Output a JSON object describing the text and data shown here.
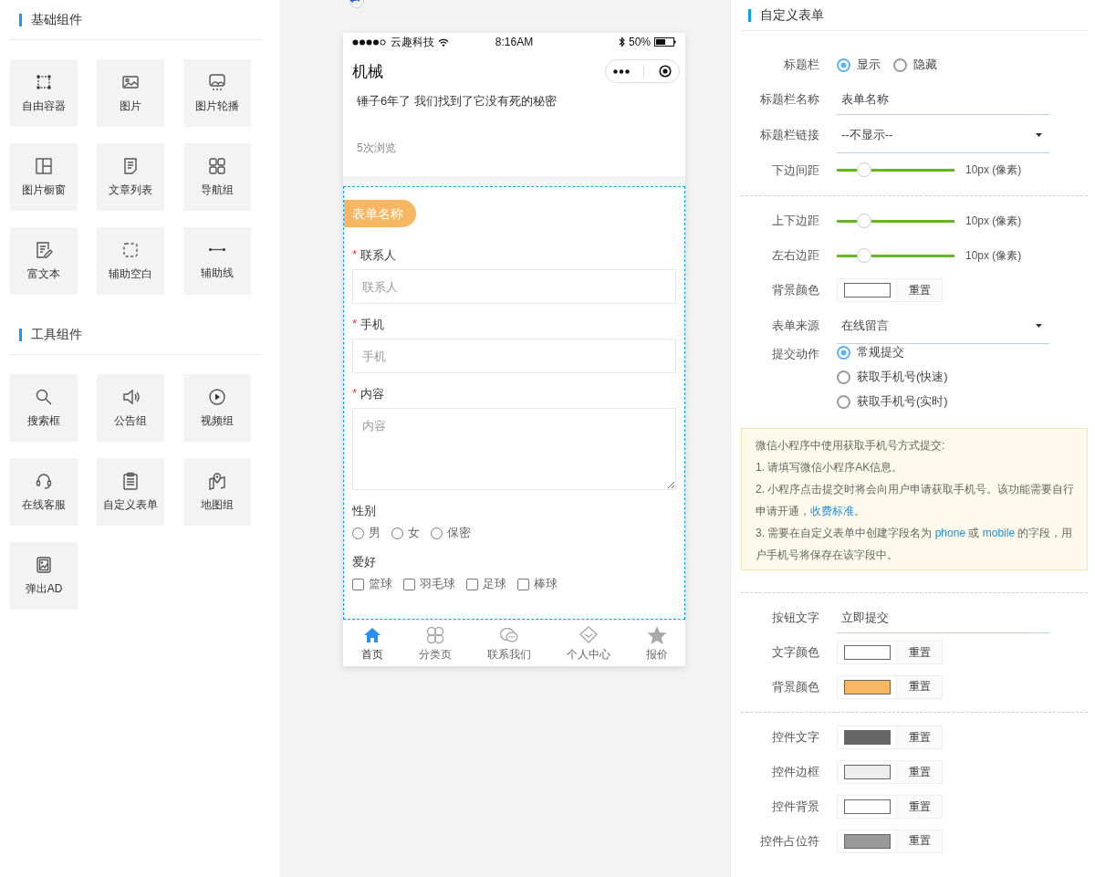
{
  "components": {
    "sections": [
      {
        "title": "基础组件",
        "items": [
          {
            "label": "自由容器"
          },
          {
            "label": "图片"
          },
          {
            "label": "图片轮播"
          },
          {
            "label": "图片橱窗"
          },
          {
            "label": "文章列表"
          },
          {
            "label": "导航组"
          },
          {
            "label": "富文本"
          },
          {
            "label": "辅助空白"
          },
          {
            "label": "辅助线"
          }
        ]
      },
      {
        "title": "工具组件",
        "items": [
          {
            "label": "搜索框"
          },
          {
            "label": "公告组"
          },
          {
            "label": "视频组"
          },
          {
            "label": "在线客服"
          },
          {
            "label": "自定义表单"
          },
          {
            "label": "地图组"
          },
          {
            "label": "弹出AD"
          }
        ]
      }
    ]
  },
  "phone": {
    "status_bar": {
      "carrier": "云趣科技",
      "time": "8:16AM",
      "battery": "50%"
    },
    "nav": {
      "title": "机械"
    },
    "article": {
      "title": "锤子6年了 我们找到了它没有死的秘密",
      "views": "5次浏览"
    },
    "form": {
      "title": "表单名称",
      "fields": [
        {
          "kind": "text",
          "label": "联系人",
          "required_mark": "*",
          "placeholder": "联系人"
        },
        {
          "kind": "text",
          "label": "手机",
          "required_mark": "*",
          "placeholder": "手机"
        },
        {
          "kind": "textarea",
          "label": "内容",
          "required_mark": "*",
          "placeholder": "内容"
        },
        {
          "kind": "radio",
          "label": "性别",
          "options": [
            {
              "label": "男",
              "selected": false
            },
            {
              "label": "女",
              "selected": false
            },
            {
              "label": "保密",
              "selected": false
            }
          ]
        },
        {
          "kind": "checkbox",
          "label": "爱好",
          "options": [
            {
              "label": "篮球",
              "checked": false
            },
            {
              "label": "羽毛球",
              "checked": false
            },
            {
              "label": "足球",
              "checked": false
            },
            {
              "label": "棒球",
              "checked": false
            }
          ]
        }
      ]
    },
    "tabbar": [
      {
        "label": "首页",
        "selected": true
      },
      {
        "label": "分类页",
        "selected": false
      },
      {
        "label": "联系我们",
        "selected": false
      },
      {
        "label": "个人中心",
        "selected": false
      },
      {
        "label": "报价",
        "selected": false
      }
    ]
  },
  "settings": {
    "title": "自定义表单",
    "groups": [
      [
        {
          "kind": "radio",
          "label": "标题栏",
          "options": [
            {
              "label": "显示",
              "selected": true
            },
            {
              "label": "隐藏",
              "selected": false
            }
          ]
        },
        {
          "kind": "text",
          "label": "标题栏名称",
          "value": "表单名称"
        },
        {
          "kind": "select",
          "label": "标题栏链接",
          "value": "--不显示--"
        },
        {
          "kind": "slider",
          "label": "下边间距",
          "level": 0.23,
          "reading": "10px (像素)"
        }
      ],
      [
        {
          "kind": "slider",
          "label": "上下边距",
          "level": 0.23,
          "reading": "10px (像素)"
        },
        {
          "kind": "slider",
          "label": "左右边距",
          "level": 0.23,
          "reading": "10px (像素)"
        },
        {
          "kind": "color",
          "label": "背景颜色",
          "color": "#ffffff",
          "button": "重置"
        },
        {
          "kind": "select",
          "label": "表单来源",
          "value": "在线留言"
        },
        {
          "kind": "radio-stack",
          "label": "提交动作",
          "options": [
            {
              "label": "常规提交",
              "selected": true
            },
            {
              "label": "获取手机号(快速)",
              "selected": false
            },
            {
              "label": "获取手机号(实时)",
              "selected": false
            }
          ]
        },
        {
          "kind": "note",
          "lines": [
            [
              {
                "text": "微信小程序中使用获取手机号方式提交:"
              }
            ],
            [
              {
                "text": "1. 请填写微信小程序AK信息。"
              }
            ],
            [
              {
                "text": "2. 小程序点击提交时将会向用户申请获取手机号。该功能需要自行申请开通，"
              },
              {
                "text": "收费标准。",
                "link": true
              }
            ],
            [
              {
                "text": "3. 需要在自定义表单中创建字段名为 "
              },
              {
                "text": "phone",
                "link": true
              },
              {
                "text": " 或 "
              },
              {
                "text": "mobile",
                "link": true
              },
              {
                "text": " 的字段，用户手机号将保存在该字段中。"
              }
            ]
          ]
        }
      ],
      [
        {
          "kind": "text",
          "label": "按钮文字",
          "value": "立即提交"
        },
        {
          "kind": "color",
          "label": "文字颜色",
          "color": "#ffffff",
          "button": "重置"
        },
        {
          "kind": "color",
          "label": "背景颜色",
          "color": "#f6b662",
          "button": "重置"
        }
      ],
      [
        {
          "kind": "color",
          "label": "控件文字",
          "color": "#666666",
          "button": "重置"
        },
        {
          "kind": "color",
          "label": "控件边框",
          "color": "#eeeeee",
          "button": "重置"
        },
        {
          "kind": "color",
          "label": "控件背景",
          "color": "#ffffff",
          "button": "重置"
        },
        {
          "kind": "color",
          "label": "控件占位符",
          "color": "#999999",
          "button": "重置"
        }
      ]
    ]
  }
}
